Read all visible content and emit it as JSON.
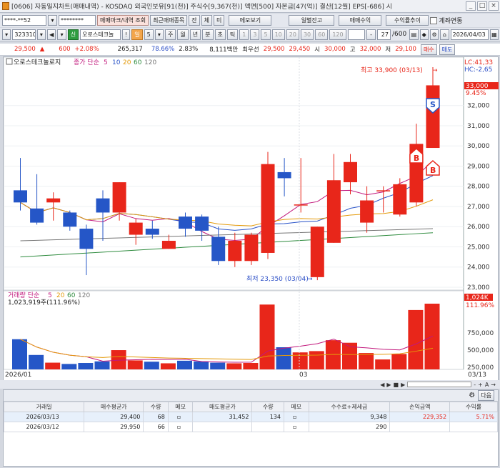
{
  "window": {
    "title": "[0606] 자동일지차트(매매내역) - KOSDAQ 외국인보유[91(천)] 주식수[9,367(천)] 액면[500] 자본금[47(억)] 결산[12월] EPS[-686] 시",
    "buttons": [
      "_",
      "□",
      "×"
    ]
  },
  "toolbar1": {
    "account": "****-**52",
    "password": "********",
    "btn_mark": "매매마크/내역 조회",
    "btn_recent": "최근매매종목",
    "btn_j": "잔",
    "btn_c": "체",
    "btn_m": "미",
    "btn_memo": "메모보기",
    "btn_daily": "일별잔고",
    "btn_profit": "매매수익",
    "btn_rate": "수익률추이",
    "chk_link": "계좌연동"
  },
  "toolbar2": {
    "code": "323310",
    "new_badge": "신",
    "stock_name": "오로스테크놀",
    "excl": "!",
    "period_sel": "일",
    "n5": "5",
    "periods": [
      "주",
      "월",
      "년",
      "분",
      "초",
      "틱"
    ],
    "nums": [
      "1",
      "3",
      "5",
      "10",
      "20",
      "30",
      "60",
      "120"
    ],
    "count": "27",
    "count_total": "/600",
    "date": "2026/04/03"
  },
  "price": {
    "current": "29,500",
    "change": "600",
    "change_pct": "+2.08%",
    "volume": "265,317",
    "vol_pct": "78.66%",
    "turnover": "2.83%",
    "amount": "8,111백만",
    "best_label": "최우선",
    "ask": "29,500",
    "bid": "29,450",
    "open_label": "시",
    "open": "30,000",
    "high_label": "고",
    "high": "32,000",
    "low_label": "저",
    "low": "29,100",
    "buy": "매수",
    "sell": "매도"
  },
  "chart": {
    "legend_name": "오로스테크놀로지",
    "legend_prefix": "종가 단순",
    "ma": [
      "5",
      "10",
      "20",
      "60",
      "120"
    ],
    "lc": "LC:41,33",
    "hc": "HC:-2,65",
    "max_label": "최고 33,900 (03/13)",
    "min_label": "최저 23,350 (03/04)",
    "last_price": "33,000",
    "last_pct": "9.45%",
    "y_ticks": [
      "32,000",
      "31,000",
      "30,000",
      "29,000",
      "28,000",
      "27,000",
      "26,000",
      "25,000",
      "24,000",
      "23,000"
    ],
    "vol_legend": "거래량 단순",
    "vol_ma": [
      "5",
      "20",
      "60",
      "120"
    ],
    "vol_info": "1,023,919주(111.96%)",
    "vol_last": "1,024K",
    "vol_pct": "111.96%",
    "vol_ticks": [
      "750,000",
      "500,000",
      "250,000"
    ],
    "x_labels": [
      "2026/01",
      "03",
      "03/13"
    ],
    "ctrl_btns": [
      "-",
      "+",
      "A"
    ]
  },
  "chart_data": {
    "type": "candlestick",
    "ylim": [
      23000,
      33900
    ],
    "candles": [
      [
        27800,
        27200,
        29400,
        26800
      ],
      [
        26900,
        26200,
        28600,
        26100
      ],
      [
        27200,
        27400,
        27700,
        26300
      ],
      [
        26700,
        26000,
        26800,
        25800
      ],
      [
        25900,
        24900,
        26100,
        23600
      ],
      [
        27400,
        26700,
        27800,
        25300
      ],
      [
        26700,
        28200,
        28200,
        26300
      ],
      [
        25600,
        26200,
        26400,
        25100
      ],
      [
        25900,
        25600,
        26300,
        25400
      ],
      [
        24900,
        25300,
        25600,
        24900
      ],
      [
        26500,
        25900,
        26700,
        25500
      ],
      [
        26500,
        25800,
        26600,
        25300
      ],
      [
        25500,
        24300,
        26000,
        24100
      ],
      [
        24300,
        25300,
        25700,
        24000
      ],
      [
        24300,
        25600,
        25700,
        24100
      ],
      [
        24700,
        29100,
        29700,
        24400
      ],
      [
        28700,
        28400,
        29400,
        27500
      ],
      [
        27100,
        27100,
        29400,
        26700
      ],
      [
        23500,
        26000,
        26000,
        23350
      ],
      [
        25200,
        28300,
        29600,
        25200
      ],
      [
        28200,
        29200,
        29600,
        27600
      ],
      [
        26200,
        27300,
        28000,
        25700
      ],
      [
        27800,
        27800,
        28000,
        26700
      ],
      [
        26600,
        28100,
        28400,
        26500
      ],
      [
        27200,
        30100,
        31100,
        27000
      ],
      [
        29900,
        33000,
        33900,
        29900
      ]
    ],
    "volumes": [
      470,
      225,
      105,
      85,
      100,
      125,
      300,
      140,
      120,
      95,
      135,
      125,
      105,
      95,
      100,
      1010,
      345,
      265,
      285,
      455,
      415,
      255,
      155,
      240,
      925,
      1024
    ],
    "vol_unit": "K",
    "trades": [
      {
        "date": "2026/03/12",
        "type": "B"
      },
      {
        "date": "2026/03/13",
        "type": "S"
      }
    ]
  },
  "table": {
    "headers": [
      "거래일",
      "매수평균가",
      "수량",
      "메모",
      "매도평균가",
      "수량",
      "메모",
      "수수료+제세금",
      "손익금액",
      "수익률"
    ],
    "rows": [
      [
        "2026/03/13",
        "29,400",
        "68",
        "",
        "31,452",
        "134",
        "",
        "9,348",
        "229,352",
        "5.71%"
      ],
      [
        "2026/03/12",
        "29,950",
        "66",
        "",
        "",
        "",
        "",
        "290",
        "",
        ""
      ]
    ],
    "next": "다음"
  },
  "colors": {
    "up": "#e8261a",
    "down": "#2556c7",
    "ma5": "#c2187c",
    "ma10": "#2852c8",
    "ma20": "#e49a0a",
    "ma60": "#2e8b3e",
    "ma120": "#777777"
  }
}
